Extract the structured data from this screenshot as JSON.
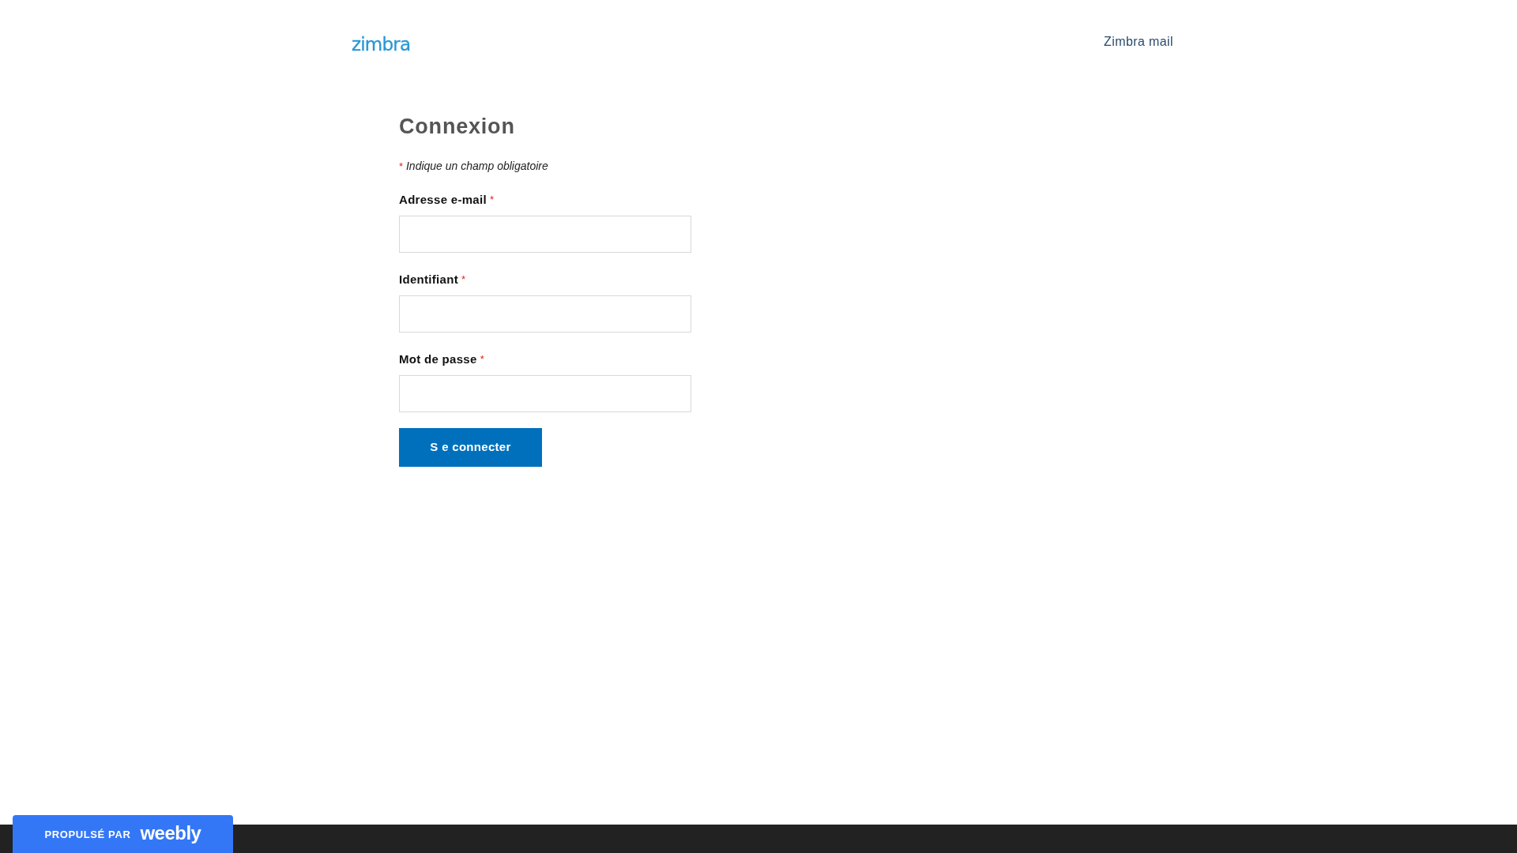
{
  "header": {
    "logo": "zimbra",
    "nav_link": "Zimbra mail"
  },
  "form": {
    "title": "Connexion",
    "required_note": {
      "mark": "*",
      "text": "Indique un champ obligatoire"
    },
    "fields": [
      {
        "label": "Adresse e-mail",
        "required_mark": "*"
      },
      {
        "label": "Identifiant",
        "required_mark": "*"
      },
      {
        "label": "Mot de passe",
        "required_mark": "*"
      }
    ],
    "submit": "S e connecter"
  },
  "footer": {
    "badge": {
      "prefix": "PROPULSÉ PAR",
      "brand": "weebly"
    }
  }
}
